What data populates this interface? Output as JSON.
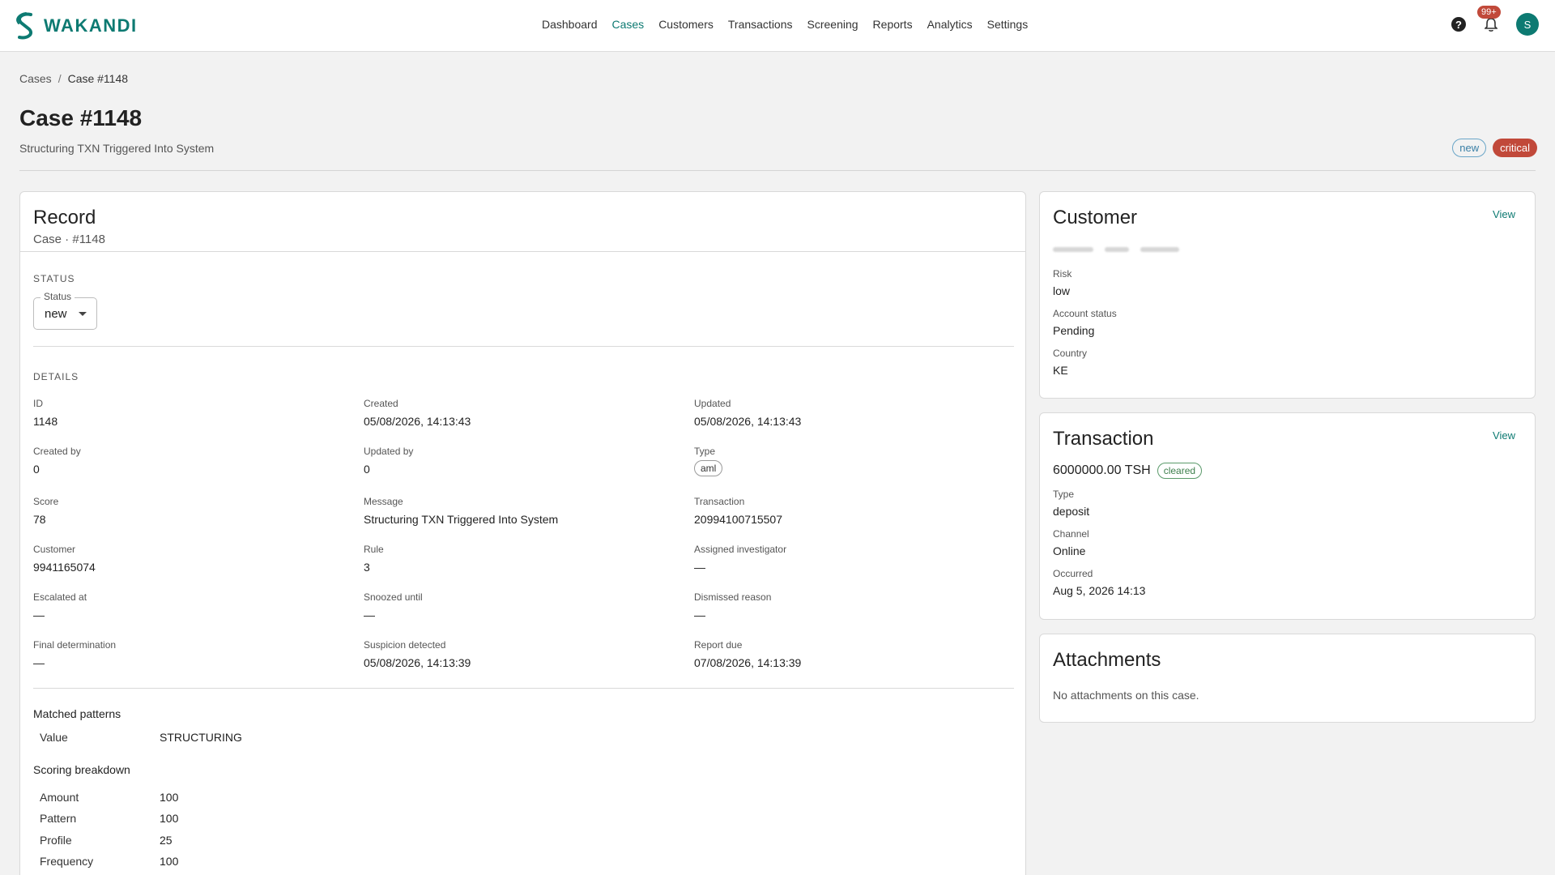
{
  "app": {
    "name": "WAKANDI"
  },
  "nav": {
    "items": [
      "Dashboard",
      "Cases",
      "Customers",
      "Transactions",
      "Screening",
      "Reports",
      "Analytics",
      "Settings"
    ],
    "active": "Cases"
  },
  "topbar": {
    "notification_count": "99+",
    "avatar_initial": "S",
    "help_symbol": "?"
  },
  "breadcrumb": {
    "root": "Cases",
    "separator": "/",
    "current": "Case #1148"
  },
  "header": {
    "title": "Case #1148",
    "subtitle": "Structuring TXN Triggered Into System",
    "badges": {
      "status": "new",
      "severity": "critical"
    }
  },
  "record": {
    "title": "Record",
    "subtitle": "Case · #1148",
    "status_section": "STATUS",
    "status_field": {
      "label": "Status",
      "value": "new"
    },
    "details_section": "DETAILS",
    "fields": {
      "id": {
        "label": "ID",
        "value": "1148"
      },
      "created": {
        "label": "Created",
        "value": "05/08/2026, 14:13:43"
      },
      "updated": {
        "label": "Updated",
        "value": "05/08/2026, 14:13:43"
      },
      "created_by": {
        "label": "Created by",
        "value": "0"
      },
      "updated_by": {
        "label": "Updated by",
        "value": "0"
      },
      "type": {
        "label": "Type",
        "value": "aml"
      },
      "score": {
        "label": "Score",
        "value": "78"
      },
      "message": {
        "label": "Message",
        "value": "Structuring TXN Triggered Into System"
      },
      "transaction": {
        "label": "Transaction",
        "value": "20994100715507"
      },
      "customer": {
        "label": "Customer",
        "value": "9941165074"
      },
      "rule": {
        "label": "Rule",
        "value": "3"
      },
      "assigned_investigator": {
        "label": "Assigned investigator",
        "value": "—"
      },
      "escalated_at": {
        "label": "Escalated at",
        "value": "—"
      },
      "snoozed_until": {
        "label": "Snoozed until",
        "value": "—"
      },
      "dismissed_reason": {
        "label": "Dismissed reason",
        "value": "—"
      },
      "final_determination": {
        "label": "Final determination",
        "value": "—"
      },
      "suspicion_detected": {
        "label": "Suspicion detected",
        "value": "05/08/2026, 14:13:39"
      },
      "report_due": {
        "label": "Report due",
        "value": "07/08/2026, 14:13:39"
      }
    },
    "matched_patterns": {
      "heading": "Matched patterns",
      "rows": [
        {
          "key": "Value",
          "value": "STRUCTURING"
        }
      ]
    },
    "scoring_breakdown": {
      "heading": "Scoring breakdown",
      "rows": [
        {
          "key": "Amount",
          "value": "100"
        },
        {
          "key": "Pattern",
          "value": "100"
        },
        {
          "key": "Profile",
          "value": "25"
        },
        {
          "key": "Frequency",
          "value": "100"
        }
      ]
    }
  },
  "customer_card": {
    "title": "Customer",
    "view_label": "View",
    "risk": {
      "label": "Risk",
      "value": "low"
    },
    "account_status": {
      "label": "Account status",
      "value": "Pending"
    },
    "country": {
      "label": "Country",
      "value": "KE"
    }
  },
  "transaction_card": {
    "title": "Transaction",
    "view_label": "View",
    "amount": "6000000.00 TSH",
    "status": "cleared",
    "type": {
      "label": "Type",
      "value": "deposit"
    },
    "channel": {
      "label": "Channel",
      "value": "Online"
    },
    "occurred": {
      "label": "Occurred",
      "value": "Aug 5, 2026 14:13"
    }
  },
  "attachments_card": {
    "title": "Attachments",
    "empty_text": "No attachments on this case."
  },
  "colors": {
    "brand": "#0d7a72",
    "critical": "#c1493a",
    "new_badge": "#3a7fa6",
    "cleared": "#3d7f4c"
  }
}
